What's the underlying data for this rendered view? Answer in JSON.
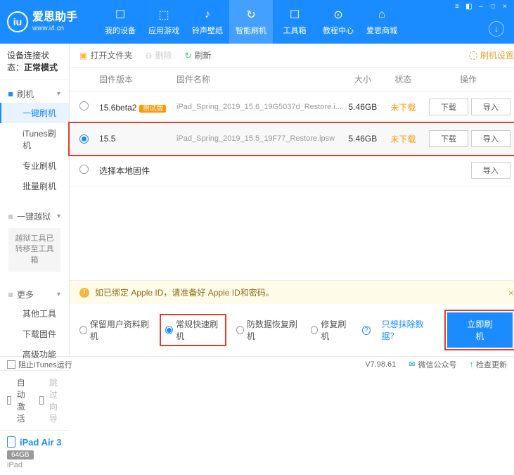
{
  "header": {
    "logo_title": "爱思助手",
    "logo_url": "www.i4.cn",
    "nav": [
      "我的设备",
      "应用游戏",
      "铃声壁纸",
      "智能刷机",
      "工具箱",
      "教程中心",
      "爱思商城"
    ]
  },
  "sidebar": {
    "status_label": "设备连接状态：",
    "status_value": "正常模式",
    "flash_head": "刷机",
    "items_flash": [
      "一键刷机",
      "iTunes刷机",
      "专业刷机",
      "批量刷机"
    ],
    "jb_head": "一键越狱",
    "jb_note": "越狱工具已转移至工具箱",
    "more_head": "更多",
    "items_more": [
      "其他工具",
      "下载固件",
      "高级功能"
    ],
    "auto_activate": "自动激活",
    "skip_guide": "跳过向导",
    "device_name": "iPad Air 3",
    "device_storage": "64GB",
    "device_type": "iPad"
  },
  "toolbar": {
    "open": "打开文件夹",
    "delete": "删除",
    "refresh": "刷新",
    "settings": "刷机设置"
  },
  "table": {
    "h_ver": "固件版本",
    "h_name": "固件名称",
    "h_size": "大小",
    "h_state": "状态",
    "h_ops": "操作",
    "rows": [
      {
        "ver": "15.6beta2",
        "tag": "测试版",
        "name": "iPad_Spring_2019_15.6_19G5037d_Restore.i...",
        "size": "5.46GB",
        "state": "未下载"
      },
      {
        "ver": "15.5",
        "tag": "",
        "name": "iPad_Spring_2019_15.5_19F77_Restore.ipsw",
        "size": "5.46GB",
        "state": "未下载"
      }
    ],
    "local_fw": "选择本地固件",
    "btn_dl": "下载",
    "btn_imp": "导入"
  },
  "warn": {
    "text": "如已绑定 Apple ID，请准备好 Apple ID和密码。"
  },
  "options": {
    "o1": "保留用户资料刷机",
    "o2": "常规快速刷机",
    "o3": "防数据恢复刷机",
    "o4": "修复刷机",
    "link": "只想抹除数据？",
    "button": "立即刷机"
  },
  "footer": {
    "block_itunes": "阻止iTunes运行",
    "version": "V7.98.61",
    "wechat": "微信公众号",
    "update": "检查更新"
  }
}
